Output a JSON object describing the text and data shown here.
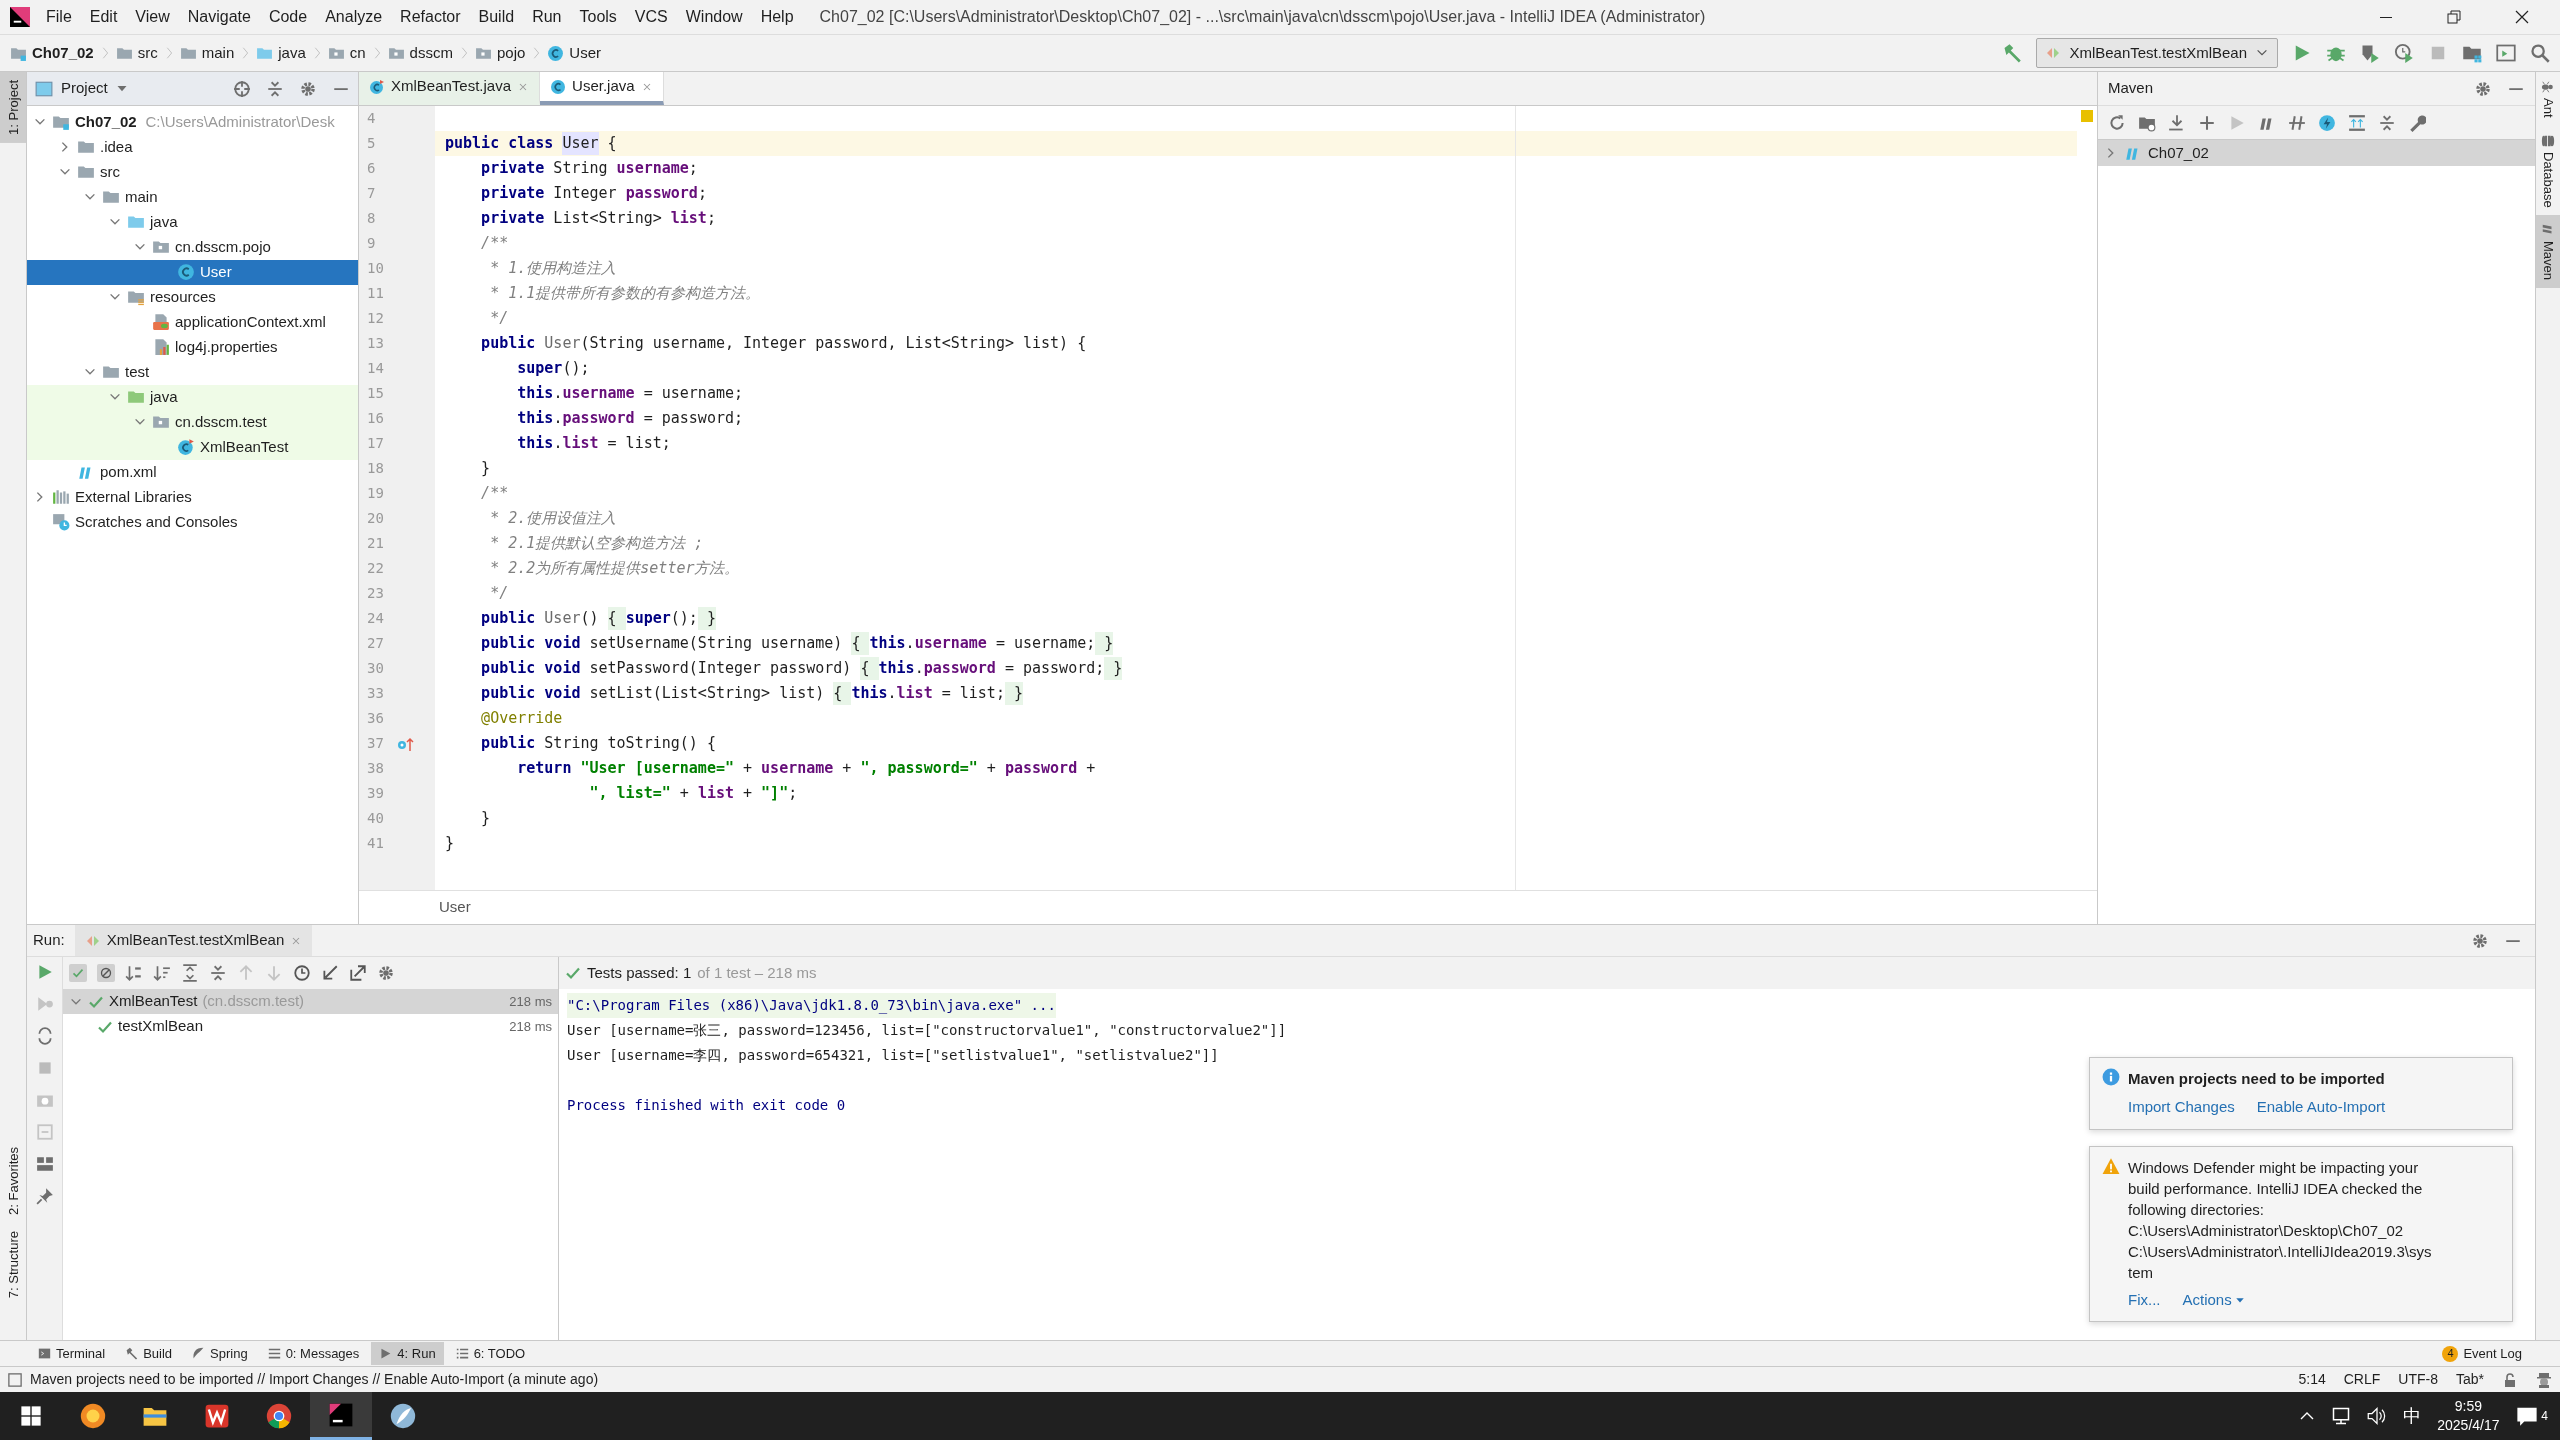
{
  "window": {
    "title": "Ch07_02 [C:\\Users\\Administrator\\Desktop\\Ch07_02] - ...\\src\\main\\java\\cn\\dsscm\\pojo\\User.java - IntelliJ IDEA (Administrator)"
  },
  "menu": [
    "File",
    "Edit",
    "View",
    "Navigate",
    "Code",
    "Analyze",
    "Refactor",
    "Build",
    "Run",
    "Tools",
    "VCS",
    "Window",
    "Help"
  ],
  "breadcrumbs": [
    {
      "label": "Ch07_02",
      "kind": "module"
    },
    {
      "label": "src",
      "kind": "folder"
    },
    {
      "label": "main",
      "kind": "folder"
    },
    {
      "label": "java",
      "kind": "folder-src"
    },
    {
      "label": "cn",
      "kind": "package"
    },
    {
      "label": "dsscm",
      "kind": "package"
    },
    {
      "label": "pojo",
      "kind": "package"
    },
    {
      "label": "User",
      "kind": "class"
    }
  ],
  "run_config": {
    "label": "XmlBeanTest.testXmlBean"
  },
  "left_tool_tabs": [
    {
      "label": "1: Project",
      "selected": true
    },
    {
      "label": "2: Favorites",
      "selected": false
    },
    {
      "label": "7: Structure",
      "selected": false
    }
  ],
  "right_tool_tabs": [
    {
      "label": "Ant",
      "kind": "ant",
      "selected": false
    },
    {
      "label": "Database",
      "kind": "database",
      "selected": false
    },
    {
      "label": "Maven",
      "kind": "maven",
      "selected": true
    }
  ],
  "project_pane": {
    "title": "Project",
    "tree": [
      {
        "label": "Ch07_02",
        "hint": "C:\\Users\\Administrator\\Desk",
        "kind": "module",
        "expanded": true,
        "selected": false,
        "test_sources": false,
        "children": [
          {
            "label": ".idea",
            "kind": "folder",
            "expanded": false,
            "selected": false,
            "test_sources": false
          },
          {
            "label": "src",
            "kind": "folder",
            "expanded": true,
            "selected": false,
            "test_sources": false,
            "children": [
              {
                "label": "main",
                "kind": "folder",
                "expanded": true,
                "selected": false,
                "test_sources": false,
                "children": [
                  {
                    "label": "java",
                    "kind": "folder-src",
                    "expanded": true,
                    "selected": false,
                    "test_sources": false,
                    "children": [
                      {
                        "label": "cn.dsscm.pojo",
                        "kind": "package",
                        "expanded": true,
                        "selected": false,
                        "test_sources": false,
                        "children": [
                          {
                            "label": "User",
                            "kind": "class",
                            "selected": true,
                            "test_sources": false
                          }
                        ]
                      }
                    ]
                  },
                  {
                    "label": "resources",
                    "kind": "folder-res",
                    "expanded": true,
                    "selected": false,
                    "test_sources": false,
                    "children": [
                      {
                        "label": "applicationContext.xml",
                        "kind": "xml",
                        "selected": false,
                        "test_sources": false
                      },
                      {
                        "label": "log4j.properties",
                        "kind": "properties",
                        "selected": false,
                        "test_sources": false
                      }
                    ]
                  }
                ]
              },
              {
                "label": "test",
                "kind": "folder",
                "expanded": true,
                "selected": false,
                "test_sources": false,
                "children": [
                  {
                    "label": "java",
                    "kind": "folder-test",
                    "expanded": true,
                    "selected": false,
                    "test_sources": true,
                    "children": [
                      {
                        "label": "cn.dsscm.test",
                        "kind": "package",
                        "expanded": true,
                        "selected": false,
                        "test_sources": true,
                        "children": [
                          {
                            "label": "XmlBeanTest",
                            "kind": "test-class",
                            "selected": false,
                            "test_sources": true
                          }
                        ]
                      }
                    ]
                  }
                ]
              }
            ]
          },
          {
            "label": "pom.xml",
            "kind": "maven",
            "selected": false,
            "test_sources": false
          }
        ]
      },
      {
        "label": "External Libraries",
        "kind": "libraries",
        "expanded": false,
        "selected": false,
        "test_sources": false
      },
      {
        "label": "Scratches and Consoles",
        "kind": "scratch",
        "selected": false,
        "test_sources": false
      }
    ]
  },
  "editor": {
    "tabs": [
      {
        "label": "XmlBeanTest.java",
        "kind": "test-class",
        "selected": false
      },
      {
        "label": "User.java",
        "kind": "class",
        "selected": true
      }
    ],
    "lines": [
      {
        "number": "4"
      },
      {
        "number": "5",
        "current": true,
        "override_icon": false,
        "segments": [
          {
            "text": "public class ",
            "kind": "kw"
          },
          {
            "text": "User",
            "kind": "usage"
          },
          {
            "text": " {",
            "kind": "plain"
          }
        ]
      },
      {
        "number": "6",
        "current": false,
        "override_icon": false,
        "segments": [
          {
            "text": "    private",
            "kind": "kw"
          },
          {
            "text": " String ",
            "kind": "plain"
          },
          {
            "text": "username",
            "kind": "field"
          },
          {
            "text": ";",
            "kind": "plain"
          }
        ]
      },
      {
        "number": "7",
        "current": false,
        "override_icon": false,
        "segments": [
          {
            "text": "    private",
            "kind": "kw"
          },
          {
            "text": " Integer ",
            "kind": "plain"
          },
          {
            "text": "password",
            "kind": "field"
          },
          {
            "text": ";",
            "kind": "plain"
          }
        ]
      },
      {
        "number": "8",
        "current": false,
        "override_icon": false,
        "segments": [
          {
            "text": "    private",
            "kind": "kw"
          },
          {
            "text": " List<String> ",
            "kind": "plain"
          },
          {
            "text": "list",
            "kind": "field"
          },
          {
            "text": ";",
            "kind": "plain"
          }
        ]
      },
      {
        "number": "9",
        "current": false,
        "override_icon": false,
        "segments": [
          {
            "text": "    /**",
            "kind": "comment"
          }
        ]
      },
      {
        "number": "10",
        "current": false,
        "override_icon": false,
        "segments": [
          {
            "text": "     * 1.使用构造注入",
            "kind": "comment"
          }
        ]
      },
      {
        "number": "11",
        "current": false,
        "override_icon": false,
        "segments": [
          {
            "text": "     * 1.1提供带所有参数的有参构造方法。",
            "kind": "comment"
          }
        ]
      },
      {
        "number": "12",
        "current": false,
        "override_icon": false,
        "segments": [
          {
            "text": "     */",
            "kind": "comment"
          }
        ]
      },
      {
        "number": "13",
        "current": false,
        "override_icon": false,
        "segments": [
          {
            "text": "    public ",
            "kind": "kw"
          },
          {
            "text": "User",
            "kind": "ctor"
          },
          {
            "text": "(String username, Integer password, List<String> list) {",
            "kind": "plain"
          }
        ]
      },
      {
        "number": "14",
        "current": false,
        "override_icon": false,
        "segments": [
          {
            "text": "        super",
            "kind": "kw"
          },
          {
            "text": "();",
            "kind": "plain"
          }
        ]
      },
      {
        "number": "15",
        "current": false,
        "override_icon": false,
        "segments": [
          {
            "text": "        this",
            "kind": "kw"
          },
          {
            "text": ".",
            "kind": "plain"
          },
          {
            "text": "username",
            "kind": "field"
          },
          {
            "text": " = username;",
            "kind": "plain"
          }
        ]
      },
      {
        "number": "16",
        "current": false,
        "override_icon": false,
        "segments": [
          {
            "text": "        this",
            "kind": "kw"
          },
          {
            "text": ".",
            "kind": "plain"
          },
          {
            "text": "password",
            "kind": "field"
          },
          {
            "text": " = password;",
            "kind": "plain"
          }
        ]
      },
      {
        "number": "17",
        "current": false,
        "override_icon": false,
        "segments": [
          {
            "text": "        this",
            "kind": "kw"
          },
          {
            "text": ".",
            "kind": "plain"
          },
          {
            "text": "list",
            "kind": "field"
          },
          {
            "text": " = list;",
            "kind": "plain"
          }
        ]
      },
      {
        "number": "18",
        "current": false,
        "override_icon": false,
        "segments": [
          {
            "text": "    }",
            "kind": "plain"
          }
        ]
      },
      {
        "number": "19",
        "current": false,
        "override_icon": false,
        "segments": [
          {
            "text": "    /**",
            "kind": "comment"
          }
        ]
      },
      {
        "number": "20",
        "current": false,
        "override_icon": false,
        "segments": [
          {
            "text": "     * 2.使用设值注入",
            "kind": "comment"
          }
        ]
      },
      {
        "number": "21",
        "current": false,
        "override_icon": false,
        "segments": [
          {
            "text": "     * 2.1提供默认空参构造方法 ;",
            "kind": "comment"
          }
        ]
      },
      {
        "number": "22",
        "current": false,
        "override_icon": false,
        "segments": [
          {
            "text": "     * 2.2为所有属性提供setter方法。",
            "kind": "comment"
          }
        ]
      },
      {
        "number": "23",
        "current": false,
        "override_icon": false,
        "segments": [
          {
            "text": "     */",
            "kind": "comment"
          }
        ]
      },
      {
        "number": "24",
        "current": false,
        "override_icon": false,
        "segments": [
          {
            "text": "    public ",
            "kind": "kw"
          },
          {
            "text": "User",
            "kind": "ctor"
          },
          {
            "text": "() ",
            "kind": "plain"
          },
          {
            "text": "{ ",
            "kind": "fold"
          },
          {
            "text": "super",
            "kind": "kw"
          },
          {
            "text": "();",
            "kind": "plain"
          },
          {
            "text": " }",
            "kind": "fold"
          }
        ]
      },
      {
        "number": "27",
        "current": false,
        "override_icon": false,
        "segments": [
          {
            "text": "    public void ",
            "kind": "kw"
          },
          {
            "text": "setUsername(String username) ",
            "kind": "plain"
          },
          {
            "text": "{ ",
            "kind": "fold"
          },
          {
            "text": "this",
            "kind": "kw"
          },
          {
            "text": ".",
            "kind": "plain"
          },
          {
            "text": "username",
            "kind": "field"
          },
          {
            "text": " = username;",
            "kind": "plain"
          },
          {
            "text": " }",
            "kind": "fold"
          }
        ]
      },
      {
        "number": "30",
        "current": false,
        "override_icon": false,
        "segments": [
          {
            "text": "    public void ",
            "kind": "kw"
          },
          {
            "text": "setPassword(Integer password) ",
            "kind": "plain"
          },
          {
            "text": "{ ",
            "kind": "fold"
          },
          {
            "text": "this",
            "kind": "kw"
          },
          {
            "text": ".",
            "kind": "plain"
          },
          {
            "text": "password",
            "kind": "field"
          },
          {
            "text": " = password;",
            "kind": "plain"
          },
          {
            "text": " }",
            "kind": "fold"
          }
        ]
      },
      {
        "number": "33",
        "current": false,
        "override_icon": false,
        "segments": [
          {
            "text": "    public void ",
            "kind": "kw"
          },
          {
            "text": "setList(List<String> list) ",
            "kind": "plain"
          },
          {
            "text": "{ ",
            "kind": "fold"
          },
          {
            "text": "this",
            "kind": "kw"
          },
          {
            "text": ".",
            "kind": "plain"
          },
          {
            "text": "list",
            "kind": "field"
          },
          {
            "text": " = list;",
            "kind": "plain"
          },
          {
            "text": " }",
            "kind": "fold"
          }
        ]
      },
      {
        "number": "36",
        "current": false,
        "override_icon": false,
        "segments": [
          {
            "text": "    @Override",
            "kind": "annotation"
          }
        ]
      },
      {
        "number": "37",
        "current": false,
        "override_icon": true,
        "segments": [
          {
            "text": "    public ",
            "kind": "kw"
          },
          {
            "text": "String toString() {",
            "kind": "plain"
          }
        ]
      },
      {
        "number": "38",
        "current": false,
        "override_icon": false,
        "segments": [
          {
            "text": "        return ",
            "kind": "kw"
          },
          {
            "text": "\"User [username=\"",
            "kind": "string"
          },
          {
            "text": " + ",
            "kind": "plain"
          },
          {
            "text": "username",
            "kind": "field"
          },
          {
            "text": " + ",
            "kind": "plain"
          },
          {
            "text": "\", password=\"",
            "kind": "string"
          },
          {
            "text": " + ",
            "kind": "plain"
          },
          {
            "text": "password",
            "kind": "field"
          },
          {
            "text": " +",
            "kind": "plain"
          }
        ]
      },
      {
        "number": "39",
        "current": false,
        "override_icon": false,
        "segments": [
          {
            "text": "                \", list=\"",
            "kind": "string"
          },
          {
            "text": " + ",
            "kind": "plain"
          },
          {
            "text": "list",
            "kind": "field"
          },
          {
            "text": " + ",
            "kind": "plain"
          },
          {
            "text": "\"]\"",
            "kind": "string"
          },
          {
            "text": ";",
            "kind": "plain"
          }
        ]
      },
      {
        "number": "40",
        "current": false,
        "override_icon": false,
        "segments": [
          {
            "text": "    }",
            "kind": "plain"
          }
        ]
      },
      {
        "number": "41",
        "current": false,
        "override_icon": false,
        "segments": [
          {
            "text": "}",
            "kind": "plain"
          }
        ]
      }
    ],
    "breadcrumb": "User"
  },
  "maven": {
    "title": "Maven",
    "projects": [
      {
        "label": "Ch07_02",
        "expanded": false,
        "selected": true
      }
    ]
  },
  "run": {
    "label": "Run:",
    "tab": "XmlBeanTest.testXmlBean",
    "status_main": "Tests passed: 1",
    "status_rest": "of 1 test – 218 ms",
    "tests": [
      {
        "label": "XmlBeanTest",
        "hint": "(cn.dsscm.test)",
        "time": "218 ms",
        "passed": true,
        "expanded": true,
        "selected": true,
        "children": [
          {
            "label": "testXmlBean",
            "time": "218 ms",
            "passed": true,
            "selected": false
          }
        ]
      }
    ],
    "console": [
      {
        "text": "\"C:\\Program Files (x86)\\Java\\jdk1.8.0_73\\bin\\java.exe\" ...",
        "kind": "command"
      },
      {
        "text": "User [username=张三, password=123456, list=[\"constructorvalue1\", \"constructorvalue2\"]]",
        "kind": "output"
      },
      {
        "text": "User [username=李四, password=654321, list=[\"setlistvalue1\", \"setlistvalue2\"]]",
        "kind": "output"
      },
      {
        "text": "Process finished with exit code 0",
        "kind": "exit"
      }
    ]
  },
  "notifications": [
    {
      "kind": "info",
      "title": "Maven projects need to be imported",
      "actions": [
        "Import Changes",
        "Enable Auto-Import"
      ]
    },
    {
      "kind": "warning",
      "lines": [
        "Windows Defender might be impacting your",
        "build performance. IntelliJ IDEA checked the",
        "following directories:",
        "C:\\Users\\Administrator\\Desktop\\Ch07_02",
        "C:\\Users\\Administrator\\.IntelliJIdea2019.3\\sys",
        "tem"
      ],
      "actions": [
        "Fix...",
        "Actions"
      ]
    }
  ],
  "tool_tabs": [
    {
      "label": "Terminal",
      "kind": "terminal",
      "selected": false
    },
    {
      "label": "Build",
      "kind": "build",
      "selected": false
    },
    {
      "label": "Spring",
      "kind": "spring",
      "selected": false
    },
    {
      "label": "0: Messages",
      "kind": "messages",
      "selected": false
    },
    {
      "label": "4: Run",
      "kind": "run",
      "selected": true
    },
    {
      "label": "6: TODO",
      "kind": "todo",
      "selected": false
    }
  ],
  "event_log": {
    "label": "Event Log",
    "count": "4"
  },
  "status_bar": {
    "message": "Maven projects need to be imported // Import Changes // Enable Auto-Import (a minute ago)",
    "fields": [
      "5:14",
      "CRLF",
      "UTF-8",
      "Tab*"
    ]
  },
  "taskbar": {
    "apps": [
      {
        "kind": "browser-orange",
        "active": false
      },
      {
        "kind": "explorer",
        "active": false
      },
      {
        "kind": "wps",
        "active": false
      },
      {
        "kind": "chrome",
        "active": false
      },
      {
        "kind": "intellij",
        "active": true
      },
      {
        "kind": "feather",
        "active": false
      }
    ],
    "ime": "中",
    "time": "9:59",
    "date": "2025/4/17",
    "notification_count": "4"
  }
}
